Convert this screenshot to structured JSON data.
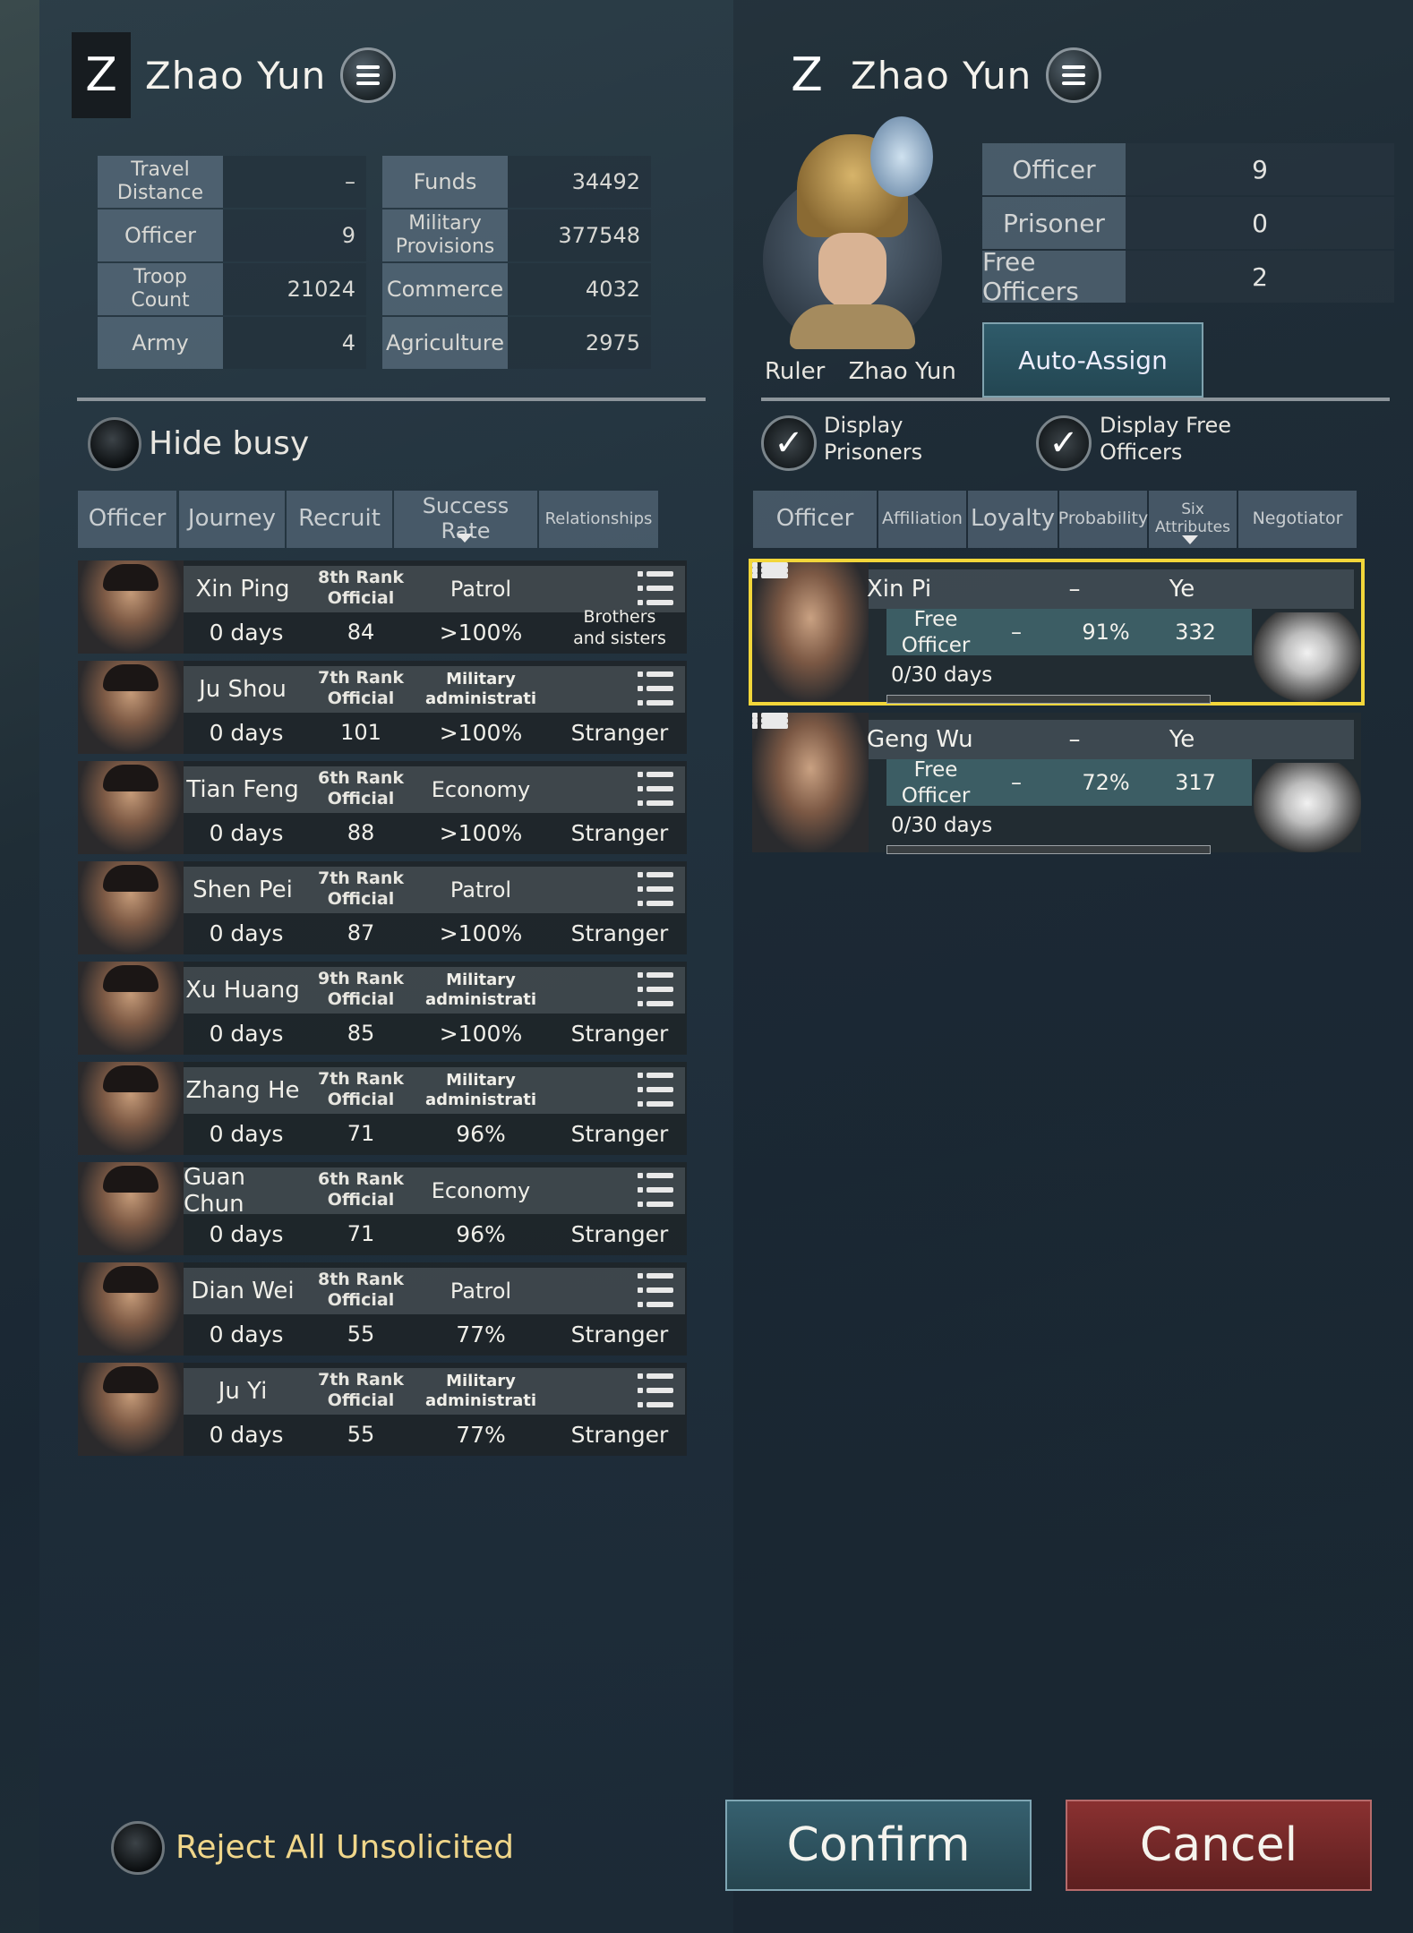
{
  "left_header": {
    "badge": "Z",
    "name": "Zhao Yun"
  },
  "right_header": {
    "badge": "Z",
    "name": "Zhao Yun"
  },
  "left_stats": [
    {
      "label": "Travel\nDistance",
      "value": "–"
    },
    {
      "label": "Officer",
      "value": "9"
    },
    {
      "label": "Troop\nCount",
      "value": "21024"
    },
    {
      "label": "Army",
      "value": "4"
    }
  ],
  "city_stats": [
    {
      "label": "Funds",
      "value": "34492"
    },
    {
      "label": "Military\nProvisions",
      "value": "377548"
    },
    {
      "label": "Commerce",
      "value": "4032"
    },
    {
      "label": "Agriculture",
      "value": "2975"
    }
  ],
  "hide_busy": "Hide busy",
  "left_columns": [
    "Officer",
    "Journey",
    "Recruit",
    "Success\nRate",
    "Relationships"
  ],
  "officers": [
    {
      "name": "Xin Ping",
      "rank": "8th Rank\nOfficial",
      "task": "Patrol",
      "days": "0 days",
      "journey": "84",
      "rate": ">100%",
      "relation": "Brothers\nand sisters"
    },
    {
      "name": "Ju Shou",
      "rank": "7th Rank\nOfficial",
      "task": "Military\nadministrati",
      "days": "0 days",
      "journey": "101",
      "rate": ">100%",
      "relation": "Stranger"
    },
    {
      "name": "Tian Feng",
      "rank": "6th Rank\nOfficial",
      "task": "Economy",
      "days": "0 days",
      "journey": "88",
      "rate": ">100%",
      "relation": "Stranger"
    },
    {
      "name": "Shen Pei",
      "rank": "7th Rank\nOfficial",
      "task": "Patrol",
      "days": "0 days",
      "journey": "87",
      "rate": ">100%",
      "relation": "Stranger"
    },
    {
      "name": "Xu Huang",
      "rank": "9th Rank\nOfficial",
      "task": "Military\nadministrati",
      "days": "0 days",
      "journey": "85",
      "rate": ">100%",
      "relation": "Stranger"
    },
    {
      "name": "Zhang He",
      "rank": "7th Rank\nOfficial",
      "task": "Military\nadministrati",
      "days": "0 days",
      "journey": "71",
      "rate": "96%",
      "relation": "Stranger"
    },
    {
      "name": "Guan Chun",
      "rank": "6th Rank\nOfficial",
      "task": "Economy",
      "days": "0 days",
      "journey": "71",
      "rate": "96%",
      "relation": "Stranger"
    },
    {
      "name": "Dian Wei",
      "rank": "8th Rank\nOfficial",
      "task": "Patrol",
      "days": "0 days",
      "journey": "55",
      "rate": "77%",
      "relation": "Stranger"
    },
    {
      "name": "Ju Yi",
      "rank": "7th Rank\nOfficial",
      "task": "Military\nadministrati",
      "days": "0 days",
      "journey": "55",
      "rate": "77%",
      "relation": "Stranger"
    }
  ],
  "ruler": {
    "label": "Ruler",
    "name": "Zhao Yun"
  },
  "right_stats": [
    {
      "label": "Officer",
      "value": "9"
    },
    {
      "label": "Prisoner",
      "value": "0"
    },
    {
      "label": "Free Officers",
      "value": "2"
    }
  ],
  "auto_assign": "Auto-Assign",
  "display_prisoners": "Display\nPrisoners",
  "display_free": "Display Free\nOfficers",
  "right_columns": [
    "Officer",
    "Affiliation",
    "Loyalty",
    "Probability",
    "Six\nAttributes",
    "Negotiator"
  ],
  "candidates": [
    {
      "name": "Xin Pi",
      "affiliation": "–",
      "location": "Ye",
      "status": "Free\nOfficer",
      "loyalty": "–",
      "probability": "91%",
      "attributes": "332",
      "days": "0/30 days",
      "selected": true
    },
    {
      "name": "Geng Wu",
      "affiliation": "–",
      "location": "Ye",
      "status": "Free\nOfficer",
      "loyalty": "–",
      "probability": "72%",
      "attributes": "317",
      "days": "0/30 days",
      "selected": false
    }
  ],
  "reject_all": "Reject All Unsolicited",
  "confirm": "Confirm",
  "cancel": "Cancel",
  "colors": {
    "accent_gold": "#f0d68a",
    "selection": "#f2d63a",
    "confirm_bg": "#2f5563",
    "cancel_bg": "#7b2a2a"
  }
}
